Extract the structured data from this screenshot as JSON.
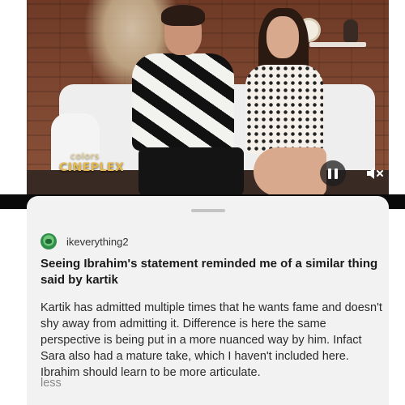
{
  "video": {
    "watermark_top": "colors",
    "watermark_bottom": "CINEPLEX",
    "controls": {
      "pause_icon": "pause-icon",
      "mute_icon": "volume-mute-icon"
    }
  },
  "post": {
    "author": "ikeverything2",
    "title": "Seeing Ibrahim's statement reminded me of a similar thing said by kartik",
    "body": "Kartik has admitted multiple times that he wants fame and doesn't shy away from admitting it. Difference is here the same perspective is being put in a more nuanced way by him. Infact Sara also had a mature take, which I haven't included here. Ibrahim should learn to be more articulate.",
    "collapse_label": "less"
  },
  "colors": {
    "sheet_background": "#f2f2f2",
    "link_gray": "#8a8a8a",
    "avatar_green": "#4caf50"
  }
}
